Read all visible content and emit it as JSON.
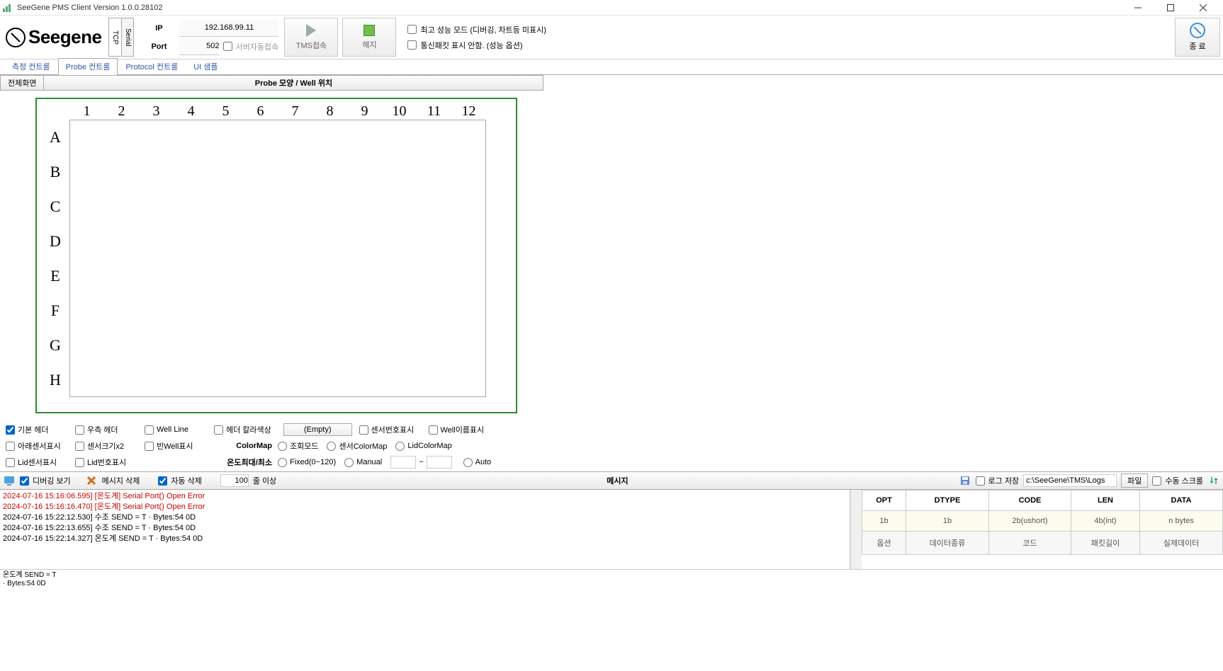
{
  "window": {
    "title": "SeeGene PMS Client Version 1.0.0.28102"
  },
  "logo": {
    "text": "Seegene"
  },
  "vtabs": {
    "tcp": "TCP",
    "serial": "Serial"
  },
  "conn": {
    "ip_label": "IP",
    "ip_value": "192.168.99.11",
    "port_label": "Port",
    "port_value": "502",
    "auto_server": "서버자동접속"
  },
  "buttons": {
    "tms_connect": "TMS접속",
    "disconnect": "해지",
    "exit": "종 료",
    "fullscreen": "전체화면",
    "empty": "(Empty)",
    "file": "파일",
    "msg_delete": "메시지 삭제"
  },
  "top_checks": {
    "perf": "최고 성능 모드 (디버깅, 차트등 미표시)",
    "packet": "통신패킷 표시 안함. (성능 옵션)"
  },
  "menutabs": {
    "t1": "측정 컨트롤",
    "t2": "Probe 컨트롤",
    "t3": "Protocol 컨트롤",
    "t4": "UI 샘플"
  },
  "subheader": "Probe 모양 / Well 위치",
  "plate": {
    "cols": [
      "1",
      "2",
      "3",
      "4",
      "5",
      "6",
      "7",
      "8",
      "9",
      "10",
      "11",
      "12"
    ],
    "rows": [
      "A",
      "B",
      "C",
      "D",
      "E",
      "F",
      "G",
      "H"
    ]
  },
  "opts": {
    "row1": {
      "basic_header": "기본 헤더",
      "right_header": "우측 헤더",
      "well_line": "Well Line",
      "header_color": "헤더 칼라색상",
      "sensor_no": "센서번호표시",
      "well_name": "Well이름표시"
    },
    "row2": {
      "below_sensor": "아래센서표시",
      "sensor_x2": "센서크기x2",
      "empty_well": "빈Well표시",
      "colormap_label": "ColorMap",
      "view_mode": "조회모드",
      "sensor_cm": "센서ColorMap",
      "lid_cm": "LidColorMap"
    },
    "row3": {
      "lid_sensor": "Lid센서표시",
      "lid_no": "Lid번호표시",
      "temp_label": "온도최대/최소",
      "fixed": "Fixed(0~120)",
      "manual": "Manual",
      "tilde": "~",
      "auto": "Auto"
    }
  },
  "msgbar": {
    "debug_view": "디버깅 보기",
    "auto_delete": "자동 삭제",
    "line_count": "100",
    "line_suffix": "줄 이상",
    "title": "메시지",
    "save_log": "로그 저장",
    "log_path": "c:\\SeeGene\\TMS\\Logs",
    "manual_scroll": "수동 스크롤"
  },
  "log": [
    {
      "cls": "err",
      "text": "2024-07-16 15:16:06.595] [온도계] Serial Port() Open Error"
    },
    {
      "cls": "err",
      "text": "2024-07-16 15:16:16.470] [온도계] Serial Port() Open Error"
    },
    {
      "cls": "",
      "text": "2024-07-16 15:22:12.530] 수조 SEND = T · Bytes:54 0D"
    },
    {
      "cls": "",
      "text": "2024-07-16 15:22:13.655] 수조 SEND = T · Bytes:54 0D"
    },
    {
      "cls": "",
      "text": "2024-07-16 15:22:14.327] 온도계 SEND = T · Bytes:54 0D"
    }
  ],
  "table": {
    "headers": [
      "OPT",
      "DTYPE",
      "CODE",
      "LEN",
      "DATA"
    ],
    "row2": [
      "1b",
      "1b",
      "2b(ushort)",
      "4b(int)",
      "n bytes"
    ],
    "row3": [
      "옵션",
      "데이터종류",
      "코드",
      "패킷길이",
      "실제데이터"
    ]
  },
  "status": {
    "l1": "온도계 SEND = T",
    "l2": "· Bytes:54 0D"
  }
}
